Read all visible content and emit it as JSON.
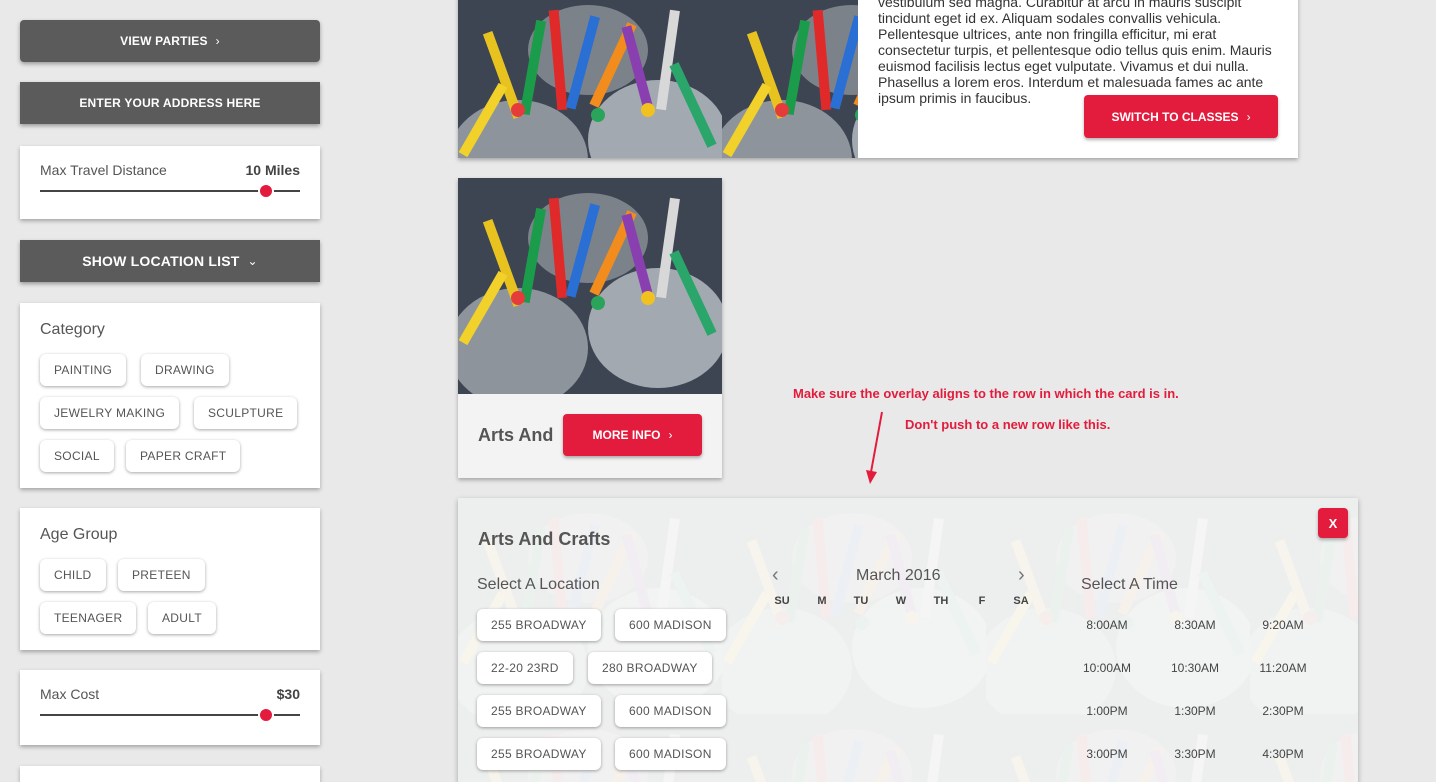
{
  "sidebar": {
    "view_parties": "VIEW PARTIES",
    "enter_address": "ENTER YOUR ADDRESS HERE",
    "travel": {
      "label": "Max Travel Distance",
      "value": "10 Miles",
      "level": 0.87
    },
    "show_locations": "SHOW LOCATION LIST",
    "category": {
      "title": "Category",
      "chips": [
        "PAINTING",
        "DRAWING",
        "JEWELRY MAKING",
        "SCULPTURE",
        "SOCIAL",
        "PAPER CRAFT"
      ]
    },
    "age_group": {
      "title": "Age Group",
      "chips": [
        "CHILD",
        "PRETEEN",
        "TEENAGER",
        "ADULT"
      ]
    },
    "cost": {
      "label": "Max Cost",
      "value": "$30",
      "level": 0.87
    }
  },
  "top_card": {
    "description": "vestibulum sed magna. Curabitur at arcu in mauris suscipit tincidunt eget id ex. Aliquam sodales convallis vehicula. Pellentesque ultrices, ante non fringilla efficitur, mi erat consectetur turpis, et pellentesque odio tellus quis enim. Mauris euismod facilisis lectus eget vulputate. Vivamus et dui nulla. Phasellus a lorem eros. Interdum et malesuada fames ac ante ipsum primis in faucibus.",
    "switch_button": "SWITCH TO CLASSES"
  },
  "small_card": {
    "title": "Arts And",
    "more_info": "MORE INFO"
  },
  "annotations": {
    "line1": "Make sure the overlay aligns to the row in which the card is in.",
    "line2": "Don't push to a new row like this."
  },
  "overlay": {
    "title": "Arts And Crafts",
    "close": "X",
    "location_heading": "Select A Location",
    "locations": [
      "255 BROADWAY",
      "600 MADISON",
      "22-20 23RD",
      "280 BROADWAY",
      "255 BROADWAY",
      "600 MADISON",
      "255 BROADWAY",
      "600 MADISON"
    ],
    "calendar": {
      "month": "March 2016",
      "days": [
        "SU",
        "M",
        "TU",
        "W",
        "TH",
        "F",
        "SA"
      ]
    },
    "time_heading": "Select A Time",
    "times": [
      "8:00AM",
      "8:30AM",
      "9:20AM",
      "10:00AM",
      "10:30AM",
      "11:20AM",
      "1:00PM",
      "1:30PM",
      "2:30PM",
      "3:00PM",
      "3:30PM",
      "4:30PM"
    ]
  },
  "colors": {
    "accent": "#e31b3c",
    "dark_button": "#5b5b5b",
    "background": "#e9e9e9"
  }
}
